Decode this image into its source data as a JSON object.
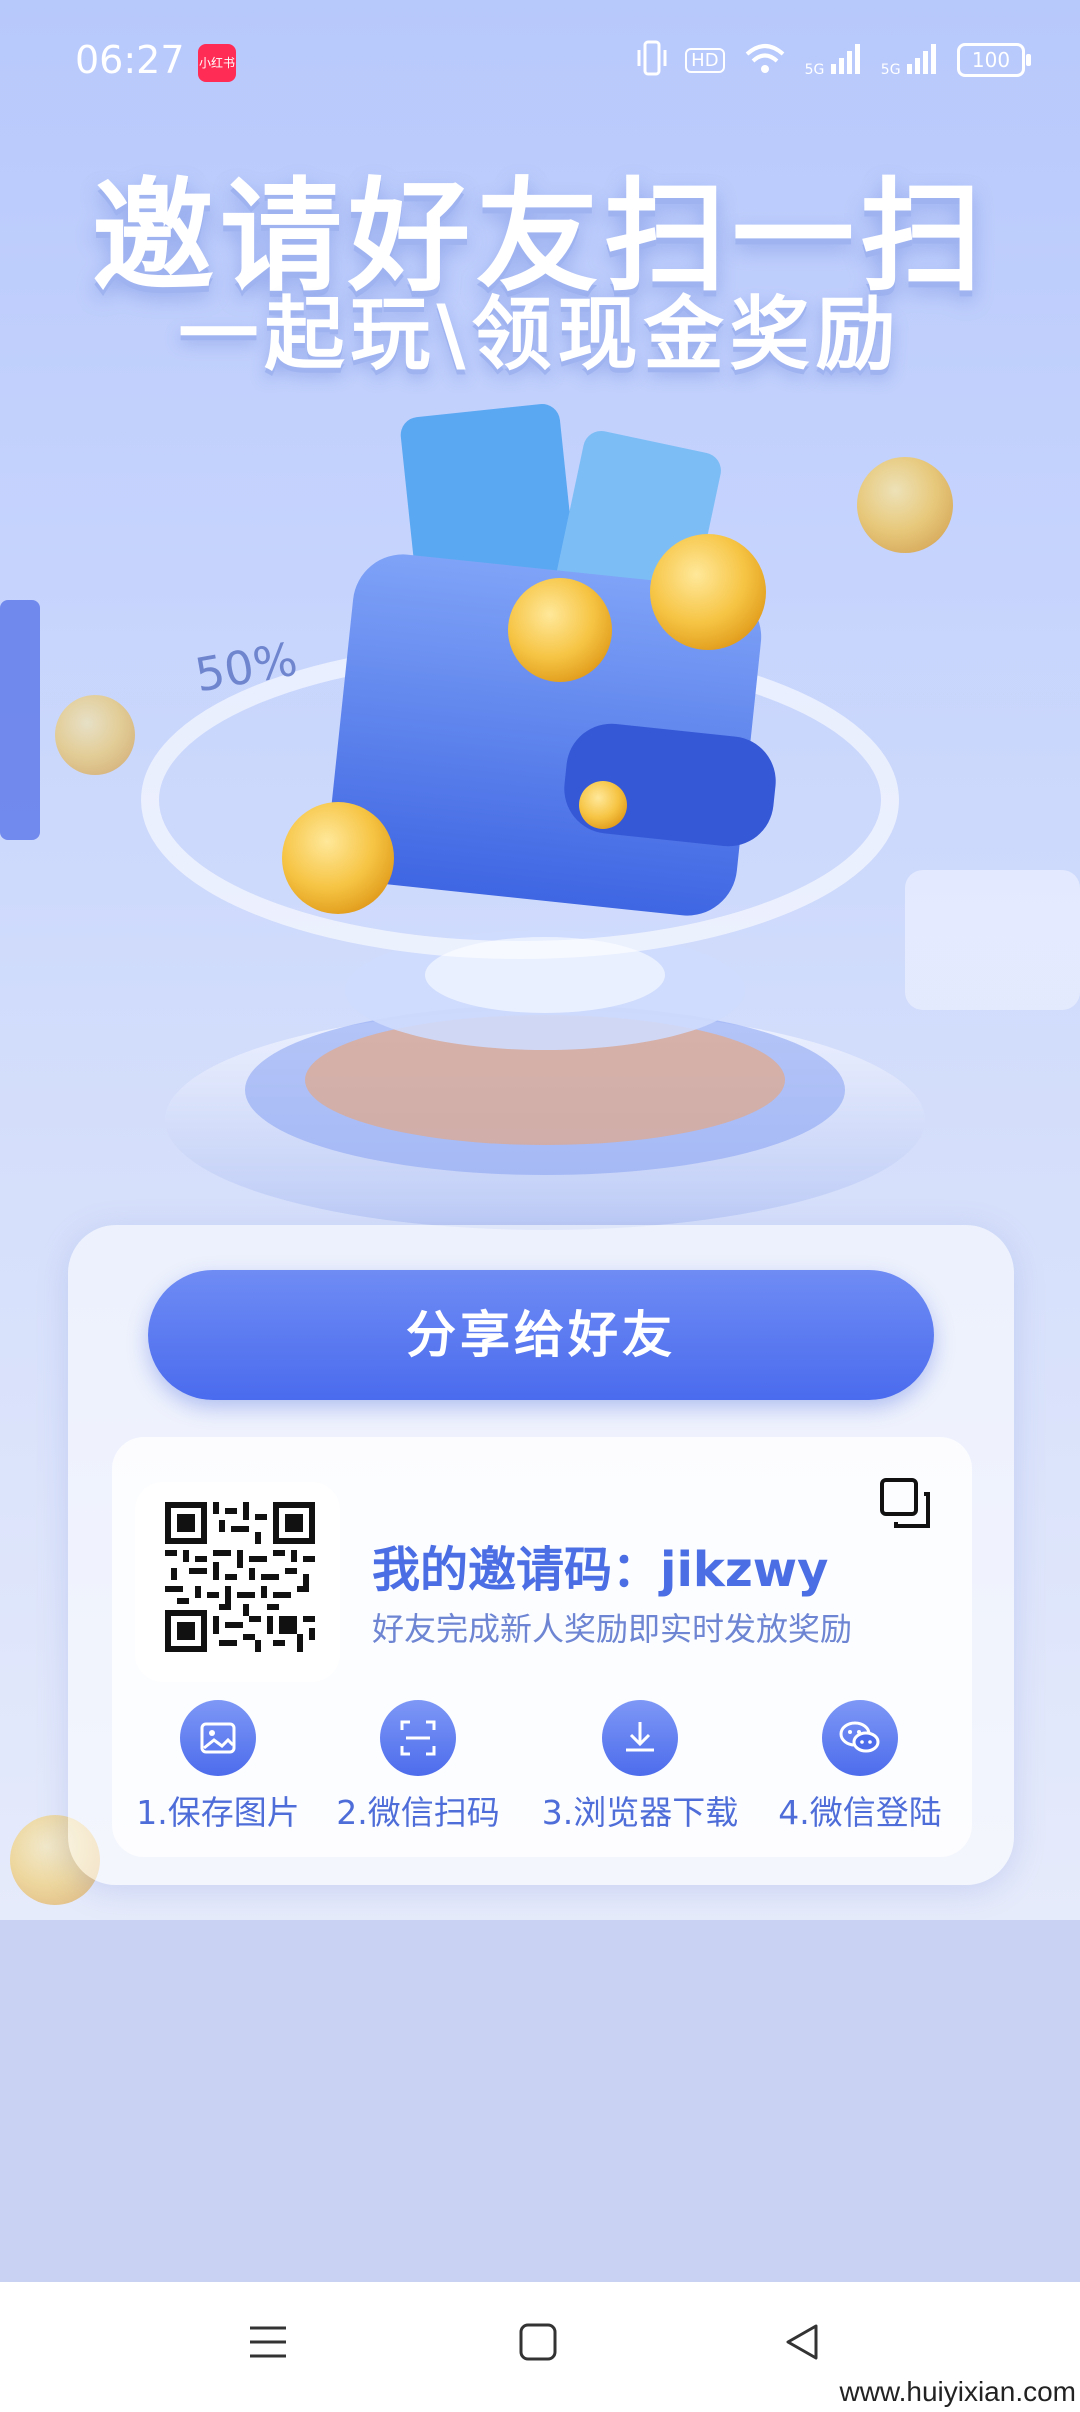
{
  "status_bar": {
    "time": "06:27",
    "app_icon_text": "小红书",
    "network": "5G",
    "network2": "5G",
    "hd": "HD",
    "battery": "100"
  },
  "hero": {
    "title": "邀请好友扫一扫",
    "subtitle": "一起玩\\领现金奖励",
    "badge": "50%"
  },
  "share_button": {
    "label": "分享给好友"
  },
  "invite": {
    "code_label": "我的邀请码：jikzwy",
    "description": "好友完成新人奖励即实时发放奖励"
  },
  "steps": [
    {
      "label": "1.保存图片",
      "icon": "image-icon"
    },
    {
      "label": "2.微信扫码",
      "icon": "scan-icon"
    },
    {
      "label": "3.浏览器下载",
      "icon": "download-icon"
    },
    {
      "label": "4.微信登陆",
      "icon": "wechat-icon"
    }
  ],
  "watermark": "www.huiyixian.com",
  "colors": {
    "accent": "#4a6bee",
    "text_blue": "#4c6ee4",
    "background": "#c9d2f3"
  }
}
